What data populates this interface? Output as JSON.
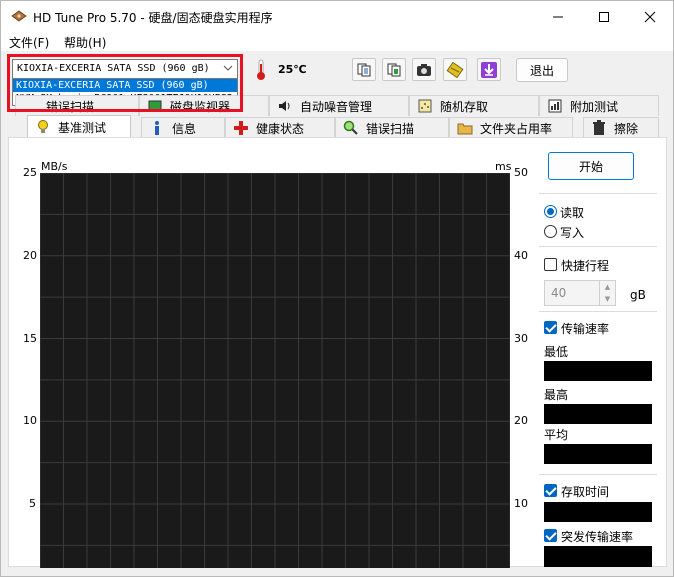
{
  "window": {
    "title": "HD Tune Pro 5.70 - 硬盘/固态硬盘实用程序"
  },
  "menu": {
    "file": "文件(F)",
    "help": "帮助(H)"
  },
  "toolbar": {
    "selected_drive": "KIOXIA-EXCERIA SATA SSD (960 gB)",
    "drive_options": [
      "KIOXIA-EXCERIA SATA SSD (960 gB)",
      "NVMeSK hynix BC901 HFS001TEJ9X10HPS2"
    ],
    "temperature": "25℃",
    "exit_label": "退出",
    "icons": [
      "thermometer-icon",
      "copy-text-icon",
      "copy-image-icon",
      "camera-icon",
      "hardware-icon",
      "download-icon"
    ]
  },
  "tabs": {
    "row1": [
      "错误扫描",
      "磁盘监视器",
      "自动噪音管理",
      "随机存取",
      "附加测试"
    ],
    "row2": [
      "基准测试",
      "信息",
      "健康状态",
      "错误扫描",
      "文件夹占用率",
      "擦除"
    ],
    "active": "基准测试"
  },
  "chart_data": {
    "type": "line",
    "title": "",
    "left_unit": "MB/s",
    "right_unit": "ms",
    "left_ticks": [
      "25",
      "20",
      "15",
      "10",
      "5"
    ],
    "right_ticks": [
      "50",
      "40",
      "30",
      "20",
      "10"
    ],
    "ylim_left": [
      0,
      25
    ],
    "ylim_right": [
      0,
      50
    ],
    "grid": true,
    "series": []
  },
  "side_panel": {
    "start_label": "开始",
    "read_label": "读取",
    "write_label": "写入",
    "read_selected": true,
    "quick_run_label": "快捷行程",
    "quick_run_checked": false,
    "quick_run_value": "40",
    "quick_run_unit": "gB",
    "transfer_rate_label": "传输速率",
    "transfer_rate_checked": true,
    "min_label": "最低",
    "max_label": "最高",
    "avg_label": "平均",
    "access_time_label": "存取时间",
    "access_time_checked": true,
    "burst_rate_label": "突发传输速率",
    "burst_rate_checked": true
  },
  "colors": {
    "accent": "#0067c0",
    "highlight_frame": "#e81123",
    "chart_bg": "#1a1a1a",
    "grid": "#3a3a3a"
  }
}
